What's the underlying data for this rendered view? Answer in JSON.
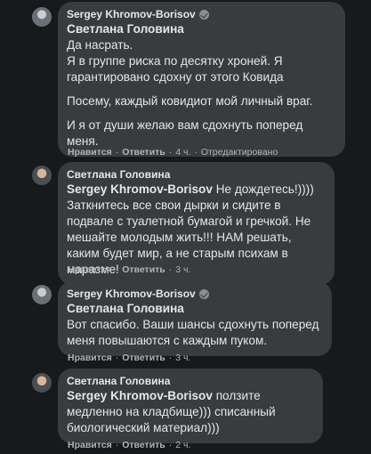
{
  "comments": [
    {
      "author": "Sergey Khromov-Borisov",
      "mention": "Светлана Головина",
      "paragraphs": [
        "Да насрать.\nЯ в группе риска по десятку хроней. Я гарантировано сдохну от этого Ковида",
        "Посему, каждый ковидиот мой личный враг.",
        "И я от души желаю вам сдохнуть поперед меня."
      ],
      "like_label": "Нравится",
      "reply_label": "Ответить",
      "time": "4 ч.",
      "edited": "Отредактировано"
    },
    {
      "author": "Светлана Головина",
      "mention": "Sergey Khromov-Borisov",
      "mention_suffix": " Не дождетесь!))))",
      "paragraphs": [
        "Заткнитесь все свои дырки и сидите в подвале с туалетной бумагой и гречкой. Не мешайте молодым жить!!! НАМ решать, каким будет мир, а не старым психам в маразме!"
      ],
      "like_label": "Нравится",
      "reply_label": "Ответить",
      "time": "3 ч."
    },
    {
      "author": "Sergey Khromov-Borisov",
      "mention": "Светлана Головина",
      "paragraphs": [
        "Вот спасибо. Ваши шансы сдохнуть поперед меня повышаются с каждым пуком."
      ],
      "like_label": "Нравится",
      "reply_label": "Ответить",
      "time": "3 ч."
    },
    {
      "author": "Светлана Головина",
      "mention": "Sergey Khromov-Borisov",
      "mention_suffix": " ползите медленно на кладбище))) списанный биологический материал)))",
      "paragraphs": [],
      "like_label": "Нравится",
      "reply_label": "Ответить",
      "time": "2 ч."
    }
  ]
}
